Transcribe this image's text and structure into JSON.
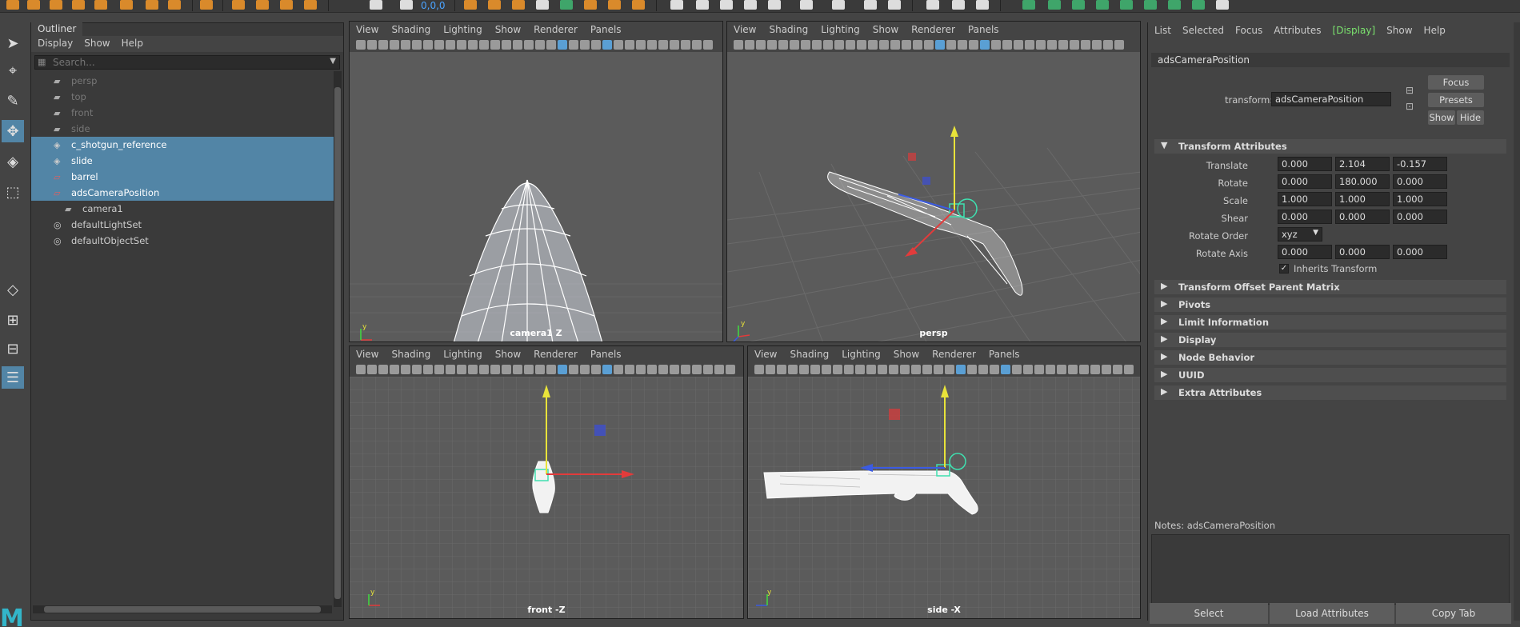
{
  "shelf": {
    "coord_readout": "0,0,0"
  },
  "outliner": {
    "tab": "Outliner",
    "menu": [
      "Display",
      "Show",
      "Help"
    ],
    "search_placeholder": "Search...",
    "items": [
      {
        "label": "persp",
        "kind": "camera",
        "state": "dim",
        "indent": 0
      },
      {
        "label": "top",
        "kind": "camera",
        "state": "dim",
        "indent": 0
      },
      {
        "label": "front",
        "kind": "camera",
        "state": "dim",
        "indent": 0
      },
      {
        "label": "side",
        "kind": "camera",
        "state": "dim",
        "indent": 0
      },
      {
        "label": "c_shotgun_reference",
        "kind": "mesh",
        "state": "selected",
        "indent": 0
      },
      {
        "label": "slide",
        "kind": "mesh",
        "state": "selected",
        "indent": 0
      },
      {
        "label": "barrel",
        "kind": "group",
        "state": "selected",
        "indent": 0
      },
      {
        "label": "adsCameraPosition",
        "kind": "group",
        "state": "selected",
        "indent": 0
      },
      {
        "label": "camera1",
        "kind": "camera",
        "state": "normal",
        "indent": 1
      },
      {
        "label": "defaultLightSet",
        "kind": "set",
        "state": "normal",
        "indent": 0
      },
      {
        "label": "defaultObjectSet",
        "kind": "set",
        "state": "normal",
        "indent": 0
      }
    ]
  },
  "viewports": {
    "menu": [
      "View",
      "Shading",
      "Lighting",
      "Show",
      "Renderer",
      "Panels"
    ],
    "top_left_label": "camera1 Z",
    "top_right_label": "persp",
    "bottom_left_label": "front -Z",
    "bottom_right_label": "side -X",
    "axis_x": "x",
    "axis_y": "y",
    "axis_z": "z"
  },
  "attr_editor": {
    "menu": [
      "List",
      "Selected",
      "Focus",
      "Attributes",
      "Display",
      "Show",
      "Help"
    ],
    "node_name": "adsCameraPosition",
    "transform_label": "transform:",
    "transform_value": "adsCameraPosition",
    "focus_btn": "Focus",
    "presets_btn": "Presets",
    "show_btn": "Show",
    "hide_btn": "Hide",
    "transform_section": "Transform Attributes",
    "translate_label": "Translate",
    "translate": [
      "0.000",
      "2.104",
      "-0.157"
    ],
    "rotate_label": "Rotate",
    "rotate": [
      "0.000",
      "180.000",
      "0.000"
    ],
    "scale_label": "Scale",
    "scale": [
      "1.000",
      "1.000",
      "1.000"
    ],
    "shear_label": "Shear",
    "shear": [
      "0.000",
      "0.000",
      "0.000"
    ],
    "rotate_order_label": "Rotate Order",
    "rotate_order": "xyz",
    "rotate_axis_label": "Rotate Axis",
    "rotate_axis": [
      "0.000",
      "0.000",
      "0.000"
    ],
    "inherits_label": "Inherits Transform",
    "sections": [
      "Transform Offset Parent Matrix",
      "Pivots",
      "Limit Information",
      "Display",
      "Node Behavior",
      "UUID",
      "Extra Attributes"
    ],
    "notes_label": "Notes:",
    "notes_node": "adsCameraPosition",
    "bottom_buttons": [
      "Select",
      "Load Attributes",
      "Copy Tab"
    ]
  },
  "colors": {
    "selection": "#5285a6",
    "accent_green": "#7be36e",
    "axis_x": "#e23b3b",
    "axis_y": "#e8e33a",
    "axis_z": "#3b5be2"
  }
}
